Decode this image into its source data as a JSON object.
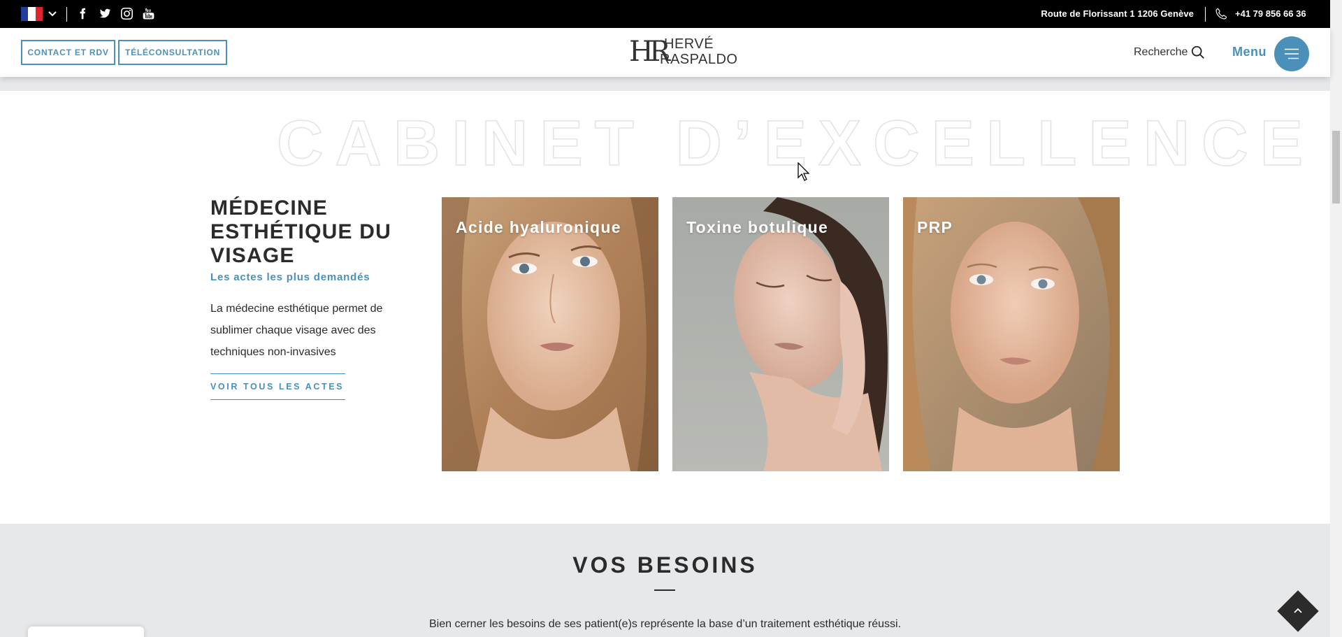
{
  "topbar": {
    "language": "FR",
    "social": [
      {
        "name": "facebook"
      },
      {
        "name": "twitter"
      },
      {
        "name": "instagram"
      },
      {
        "name": "youtube"
      }
    ],
    "address": "Route de Florissant 1 1206 Genève",
    "phone": "+41 79 856 66 36"
  },
  "header": {
    "contact_label": "CONTACT ET RDV",
    "teleconsult_label": "TÉLÉCONSULTATION",
    "logo": {
      "monogram": "HR",
      "line1": "HERVÉ",
      "line2": "RASPALDO"
    },
    "search_label": "Recherche",
    "menu_label": "Menu"
  },
  "cabinet": {
    "big_title": "CABINET D’EXCELLENCE",
    "title": "MÉDECINE ESTHÉTIQUE DU VISAGE",
    "subtitle": "Les actes les plus demandés",
    "description": "La médecine esthétique permet de sublimer chaque visage avec des techniques non-invasives",
    "see_all": "VOIR TOUS LES ACTES",
    "cards": [
      {
        "label": "Acide hyaluronique"
      },
      {
        "label": "Toxine botulique"
      },
      {
        "label": "PRP"
      }
    ]
  },
  "besoins": {
    "title": "VOS BESOINS",
    "text": "Bien cerner les besoins de ses patient(e)s représente la base d’un traitement esthétique réussi."
  },
  "colors": {
    "accent": "#4a90b8",
    "dark": "#2b2b2b",
    "band": "#e7e8ea"
  }
}
